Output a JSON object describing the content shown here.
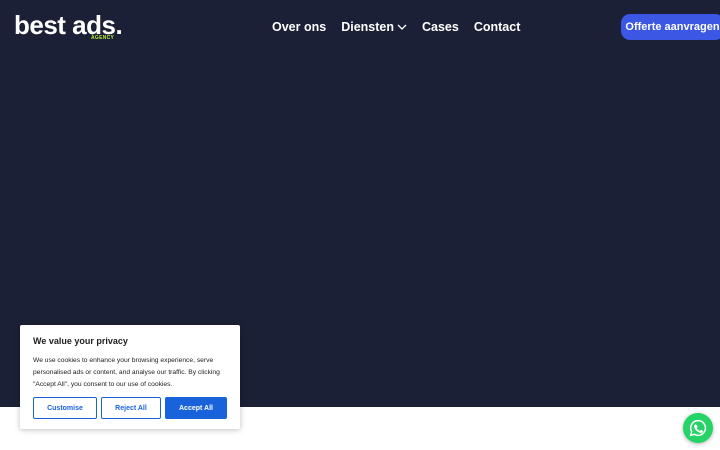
{
  "logo": {
    "main": "best ads.",
    "sub": "AGENCY"
  },
  "nav": {
    "items": [
      {
        "label": "Over ons"
      },
      {
        "label": "Diensten"
      },
      {
        "label": "Cases"
      },
      {
        "label": "Contact"
      }
    ],
    "cta_label": "Offerte aanvragen"
  },
  "cookie": {
    "title": "We value your privacy",
    "text": "We use cookies to enhance your browsing experience, serve personalised ads or content, and analyse our traffic. By clicking \"Accept All\", you consent to our use of cookies.",
    "customise_label": "Customise",
    "reject_label": "Reject All",
    "accept_label": "Accept All"
  },
  "colors": {
    "hero_bg": "#1c2036",
    "cta_bg": "#3b57e4",
    "cookie_accent": "#1863dc",
    "whatsapp": "#25d366",
    "logo_accent": "#b6f03a"
  },
  "icons": {
    "dropdown": "chevron-down-icon",
    "chat": "whatsapp-icon"
  }
}
